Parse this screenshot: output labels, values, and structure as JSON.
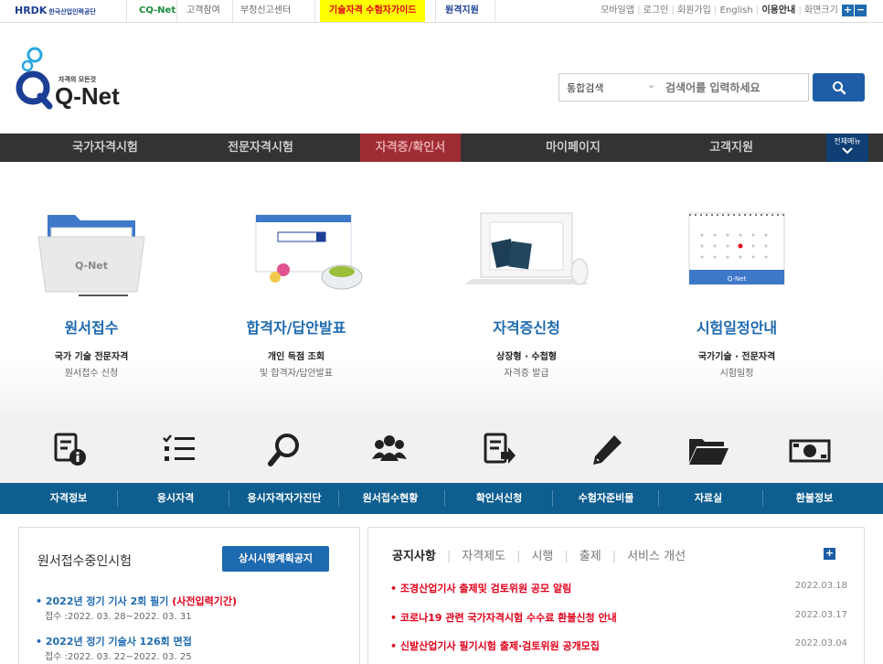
{
  "top_bar": {
    "hrdk_logo": "HRDK",
    "hrdk_logo_sub": "한국산업인력공단",
    "cqnet_logo": "CQ-Net",
    "links": [
      "고객참여",
      "부정신고센터",
      "기술자격 수험자가이드",
      "원격지원"
    ],
    "right_links": [
      "모바일앱",
      "로그인",
      "회원가입",
      "English",
      "이용안내",
      "화면크기"
    ],
    "size_plus": "+",
    "size_minus": "−"
  },
  "brand": {
    "tagline": "자격의 모든것",
    "name": "Q-Net",
    "color_blue": "#1e6ab0",
    "color_red": "#9e2c33"
  },
  "search": {
    "scope": "통합검색",
    "placeholder": "검색어를 입력하세요",
    "button_icon": "search-icon"
  },
  "main_nav": {
    "items": [
      "국가자격시험",
      "전문자격시험",
      "자격증/확인서",
      "마이페이지",
      "고객지원"
    ],
    "active": "자격증/확인서",
    "all_menu": "전체메뉴"
  },
  "services": [
    {
      "title": "원서접수",
      "line1": "국가 기술 전문자격",
      "line2": "원서접수 신청"
    },
    {
      "title": "합격자/답안발표",
      "line1": "개인 득점 조회",
      "line2": "및 합격자/답안발표"
    },
    {
      "title": "자격증신청",
      "line1": "상장형 · 수첩형",
      "line2": "자격증 발급"
    },
    {
      "title": "시험일정안내",
      "line1": "국가기술 · 전문자격",
      "line2": "시험일정"
    }
  ],
  "quick_menu": [
    {
      "label": "자격정보",
      "icon": "info-document-icon"
    },
    {
      "label": "응시자격",
      "icon": "checklist-icon"
    },
    {
      "label": "응시자격자가진단",
      "icon": "magnifier-icon"
    },
    {
      "label": "원서접수현황",
      "icon": "people-icon"
    },
    {
      "label": "확인서신청",
      "icon": "document-arrow-icon"
    },
    {
      "label": "수험자준비물",
      "icon": "pencil-icon"
    },
    {
      "label": "자료실",
      "icon": "folder-icon"
    },
    {
      "label": "환불정보",
      "icon": "money-icon"
    }
  ],
  "exam_panel": {
    "title": "원서접수중인시험",
    "button": "상시시행계획공지",
    "exams": [
      {
        "title": "• 2022년 정기 기사 2회 필기 ",
        "note": "(사전입력기간)",
        "period": "접수 :2022. 03. 28~2022. 03. 31"
      },
      {
        "title": "• 2022년 정기 기술사 126회 면접",
        "note": "",
        "period": "접수 :2022. 03. 22~2022. 03. 25"
      }
    ]
  },
  "notice_panel": {
    "tabs": [
      "공지사항",
      "자격제도",
      "시행",
      "출제",
      "서비스 개선"
    ],
    "more": "+",
    "notices": [
      {
        "title": "• 조경산업기사 출제및 검토위원 공모 알림",
        "date": "2022.03.18"
      },
      {
        "title": "• 코로나19 관련 국가자격시험 수수료 환불신청 안내",
        "date": "2022.03.17"
      },
      {
        "title": "• 신발산업기사 필기시험 출제·검토위원 공개모집",
        "date": "2022.03.04"
      }
    ]
  }
}
